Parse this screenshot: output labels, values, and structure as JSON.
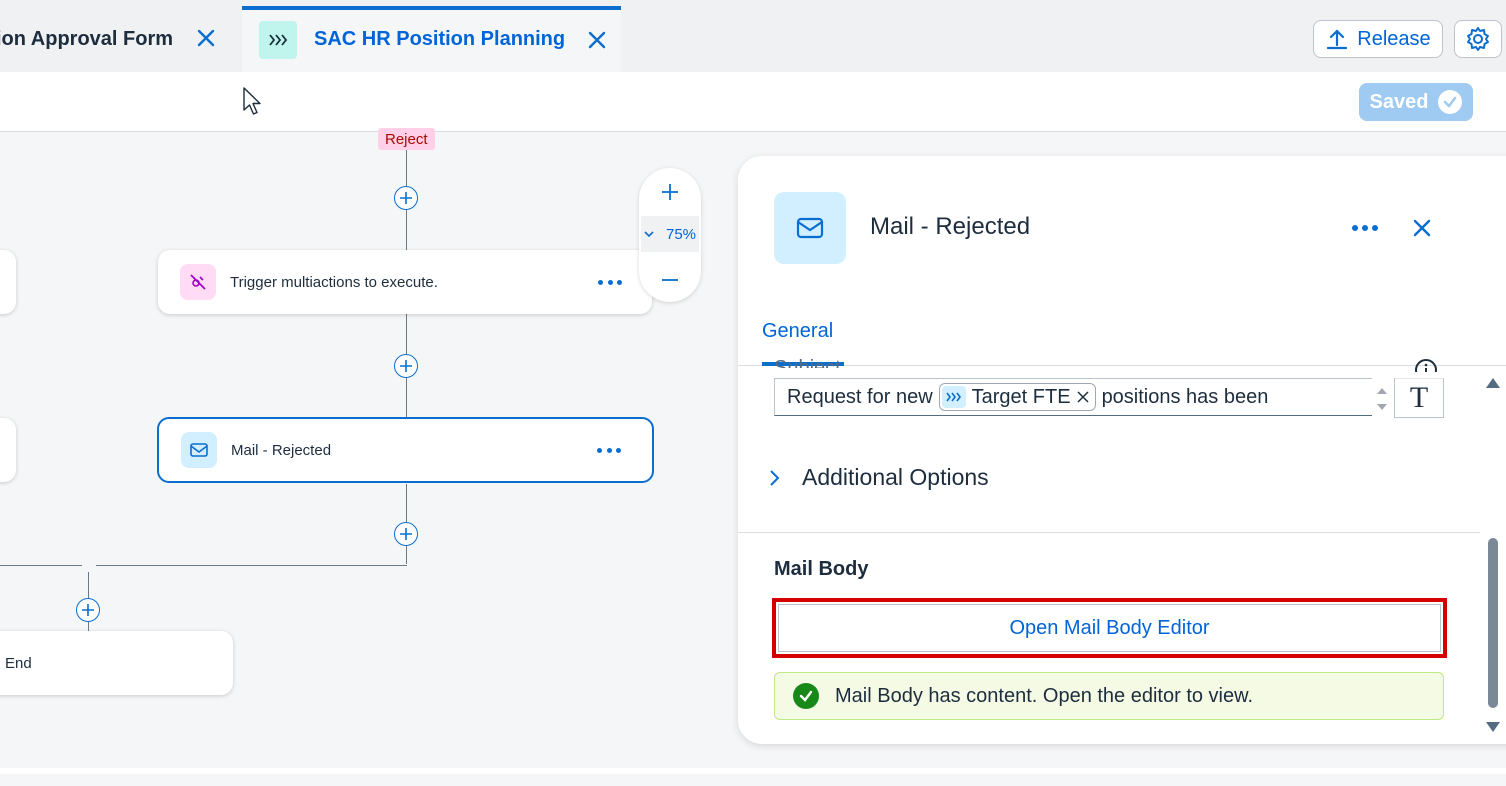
{
  "tabs": [
    {
      "label": "ion Approval Form",
      "active": false
    },
    {
      "label": "SAC HR Position Planning",
      "active": true
    }
  ],
  "header": {
    "release_label": "Release",
    "saved_label": "Saved"
  },
  "canvas": {
    "reject_tag": "Reject",
    "zoom_level": "75%",
    "nodes": [
      {
        "label": "Trigger multiactions to execute.",
        "icon": "multiaction-icon"
      },
      {
        "label": "Mail - Rejected",
        "icon": "mail-icon"
      },
      {
        "label": "End"
      }
    ]
  },
  "panel": {
    "title": "Mail - Rejected",
    "tab": "General",
    "subject_label": "Subject",
    "subject_prefix": "Request for new",
    "subject_token": "Target FTE",
    "subject_suffix": "positions has been",
    "text_format_glyph": "T",
    "additional_options": "Additional Options",
    "mail_body_label": "Mail Body",
    "open_editor_label": "Open Mail Body Editor",
    "message": "Mail Body has content. Open the editor to view."
  },
  "colors": {
    "accent": "#0a6ed1",
    "highlight_border": "#d40000",
    "success": "#188918"
  }
}
